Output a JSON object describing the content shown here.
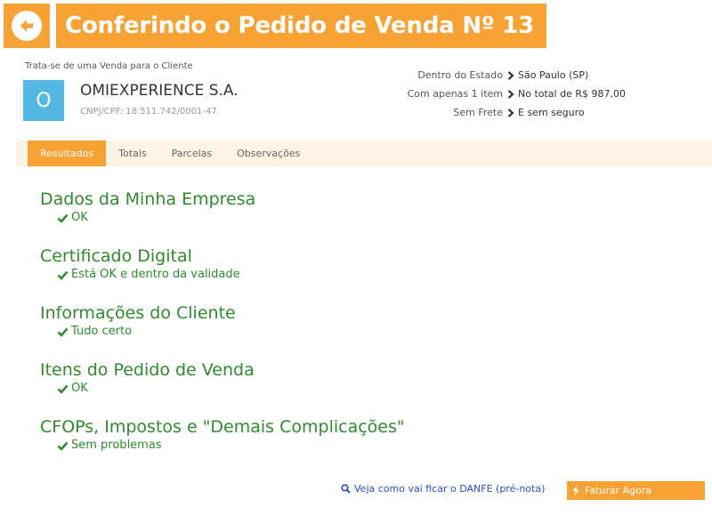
{
  "header": {
    "title": "Conferindo o Pedido de Venda Nº 13"
  },
  "client": {
    "intro": "Trata-se de uma Venda para o Cliente",
    "avatar_letter": "O",
    "name": "OMIEXPERIENCE S.A.",
    "document": "CNPJ/CPF: 18.511.742/0001-47"
  },
  "summary": [
    {
      "label": "Dentro do Estado",
      "value": "São Paulo (SP)"
    },
    {
      "label": "Com apenas 1 item",
      "value": "No total de R$ 987,00"
    },
    {
      "label": "Sem Frete",
      "value": "E sem seguro"
    }
  ],
  "tabs": [
    {
      "label": "Resultados",
      "active": true
    },
    {
      "label": "Totais",
      "active": false
    },
    {
      "label": "Parcelas",
      "active": false
    },
    {
      "label": "Observações",
      "active": false
    }
  ],
  "results": [
    {
      "title": "Dados da Minha Empresa",
      "status": "OK"
    },
    {
      "title": "Certificado Digital",
      "status": "Está OK e dentro da validade"
    },
    {
      "title": "Informações do Cliente",
      "status": "Tudo certo"
    },
    {
      "title": "Itens do Pedido de Venda",
      "status": "OK"
    },
    {
      "title": "CFOPs, Impostos e \"Demais Complicações\"",
      "status": "Sem problemas"
    }
  ],
  "actions": {
    "preview_label": "Veja como vai ficar o DANFE (pré-nota)",
    "invoice_label": "Faturar Agora"
  },
  "colors": {
    "accent_orange": "#f7a234",
    "success_green": "#2e8b2e",
    "avatar_blue": "#54b7e3",
    "link_blue": "#2a4ec9",
    "tab_bar_bg": "#fdf3e4"
  },
  "icons": {
    "back": "arrow-left-icon",
    "chevron": "chevron-right-icon",
    "check": "check-icon",
    "search": "search-icon",
    "bolt": "bolt-icon"
  }
}
